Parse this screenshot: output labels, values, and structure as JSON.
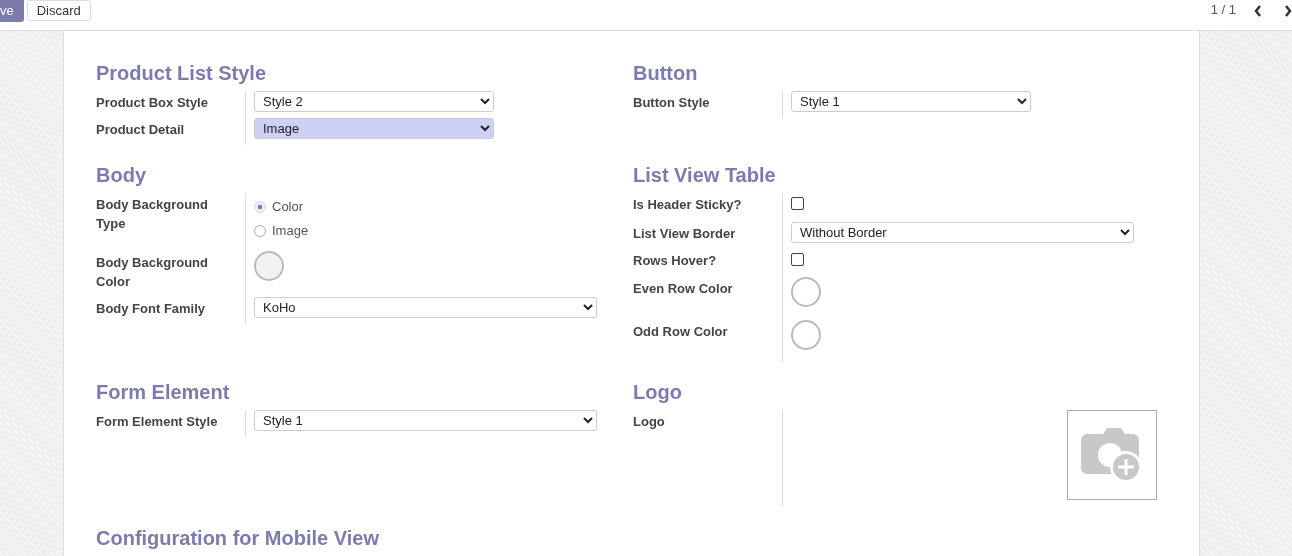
{
  "toolbar": {
    "save_button": "ve",
    "discard_button": "Discard",
    "pager": "1 / 1"
  },
  "sections": [
    {
      "title": "Product List Style",
      "fields": [
        {
          "label": "Product Box Style",
          "kind": "short-select",
          "value": "Style 2",
          "highlighted": false
        },
        {
          "label": "Product Detail",
          "kind": "short-select",
          "value": "Image",
          "highlighted": true
        }
      ]
    },
    {
      "title": "Button",
      "fields": [
        {
          "label": "Button Style",
          "kind": "short-select",
          "value": "Style 1",
          "highlighted": false
        }
      ]
    },
    {
      "title": "Body",
      "fields": [
        {
          "label": "Body Background Type",
          "kind": "radio",
          "options": [
            {
              "label": "Color",
              "selected": true
            },
            {
              "label": "Image",
              "selected": false
            }
          ]
        },
        {
          "label": "Body Background Color",
          "kind": "color",
          "color": "#f2f2f2"
        },
        {
          "label": "Body Font Family",
          "kind": "select",
          "value": "KoHo",
          "highlighted": false
        }
      ]
    },
    {
      "title": "List View Table",
      "fields": [
        {
          "label": "Is Header Sticky?",
          "kind": "checkbox",
          "checked": false
        },
        {
          "label": "List View Border",
          "kind": "select",
          "value": "Without Border",
          "highlighted": false
        },
        {
          "label": "Rows Hover?",
          "kind": "checkbox",
          "checked": false
        },
        {
          "label": "Even Row Color",
          "kind": "color",
          "color": "#ffffff"
        },
        {
          "label": "Odd Row Color",
          "kind": "color",
          "color": "#ffffff"
        }
      ]
    },
    {
      "title": "Form Element",
      "fields": [
        {
          "label": "Form Element Style",
          "kind": "select",
          "value": "Style 1",
          "highlighted": false
        }
      ]
    },
    {
      "title": "Logo",
      "fields": [
        {
          "label": "Logo",
          "kind": "image"
        }
      ]
    }
  ],
  "next_section_title": "Configuration for Mobile View"
}
